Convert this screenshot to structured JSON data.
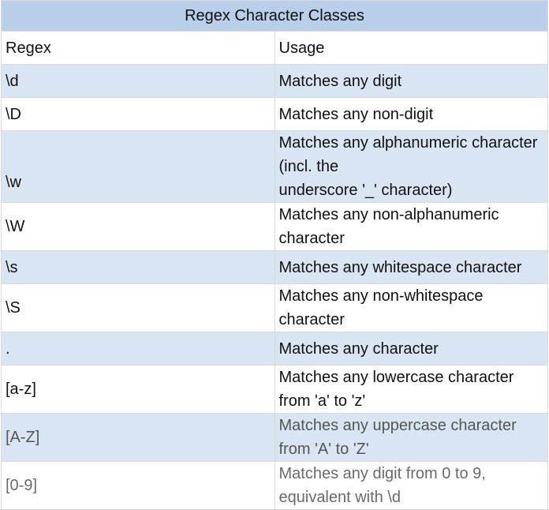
{
  "table": {
    "title": "Regex Character Classes",
    "header": {
      "regex": "Regex",
      "usage": "Usage"
    },
    "rows": [
      {
        "regex": "\\d",
        "usage": "Matches any digit"
      },
      {
        "regex": "\\D",
        "usage": "Matches any non-digit"
      },
      {
        "regex": "\\w",
        "usage_line1": "Matches any alphanumeric character (incl. the",
        "usage_line2": "underscore '_' character)"
      },
      {
        "regex": "\\W",
        "usage": "Matches any non-alphanumeric character"
      },
      {
        "regex": "\\s",
        "usage": "Matches any whitespace character"
      },
      {
        "regex": "\\S",
        "usage": "Matches any non-whitespace character"
      },
      {
        "regex": ".",
        "usage": "Matches any character"
      },
      {
        "regex": "[a-z]",
        "usage": "Matches any lowercase character from 'a' to 'z'"
      },
      {
        "regex": "[A-Z]",
        "usage": "Matches any uppercase character from 'A' to 'Z'"
      },
      {
        "regex": "[0-9]",
        "usage": "Matches any digit from 0 to 9, equivalent with \\d"
      }
    ]
  },
  "colors": {
    "title_bg": "#b9cee8",
    "row_alt_bg": "#dae5f3",
    "row_bg": "#ffffff",
    "border": "#dadada"
  }
}
